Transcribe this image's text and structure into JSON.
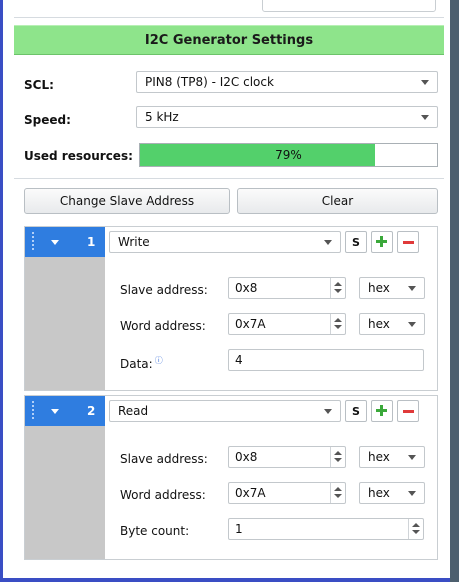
{
  "panel_title": "I2C Generator Settings",
  "settings": {
    "scl_label": "SCL:",
    "scl_value": "PIN8 (TP8) - I2C clock",
    "speed_label": "Speed:",
    "speed_value": "5 kHz",
    "used_label": "Used resources:",
    "used_percent": 79,
    "used_text": "79%"
  },
  "buttons": {
    "change_slave": "Change Slave Address",
    "clear": "Clear"
  },
  "steps": [
    {
      "number": "1",
      "operation": "Write",
      "s_label": "S",
      "slave_label": "Slave address:",
      "slave_value": "0x8",
      "slave_format": "hex",
      "word_label": "Word address:",
      "word_value": "0x7A",
      "word_format": "hex",
      "data_label": "Data:",
      "data_value": "4"
    },
    {
      "number": "2",
      "operation": "Read",
      "s_label": "S",
      "slave_label": "Slave address:",
      "slave_value": "0x8",
      "slave_format": "hex",
      "word_label": "Word address:",
      "word_value": "0x7A",
      "word_format": "hex",
      "count_label": "Byte count:",
      "count_value": "1"
    }
  ],
  "colors": {
    "header_green": "#8ee48b",
    "progress_green": "#53d06b",
    "step_blue": "#2f7de0",
    "frame_blue": "#3a4ec4"
  }
}
